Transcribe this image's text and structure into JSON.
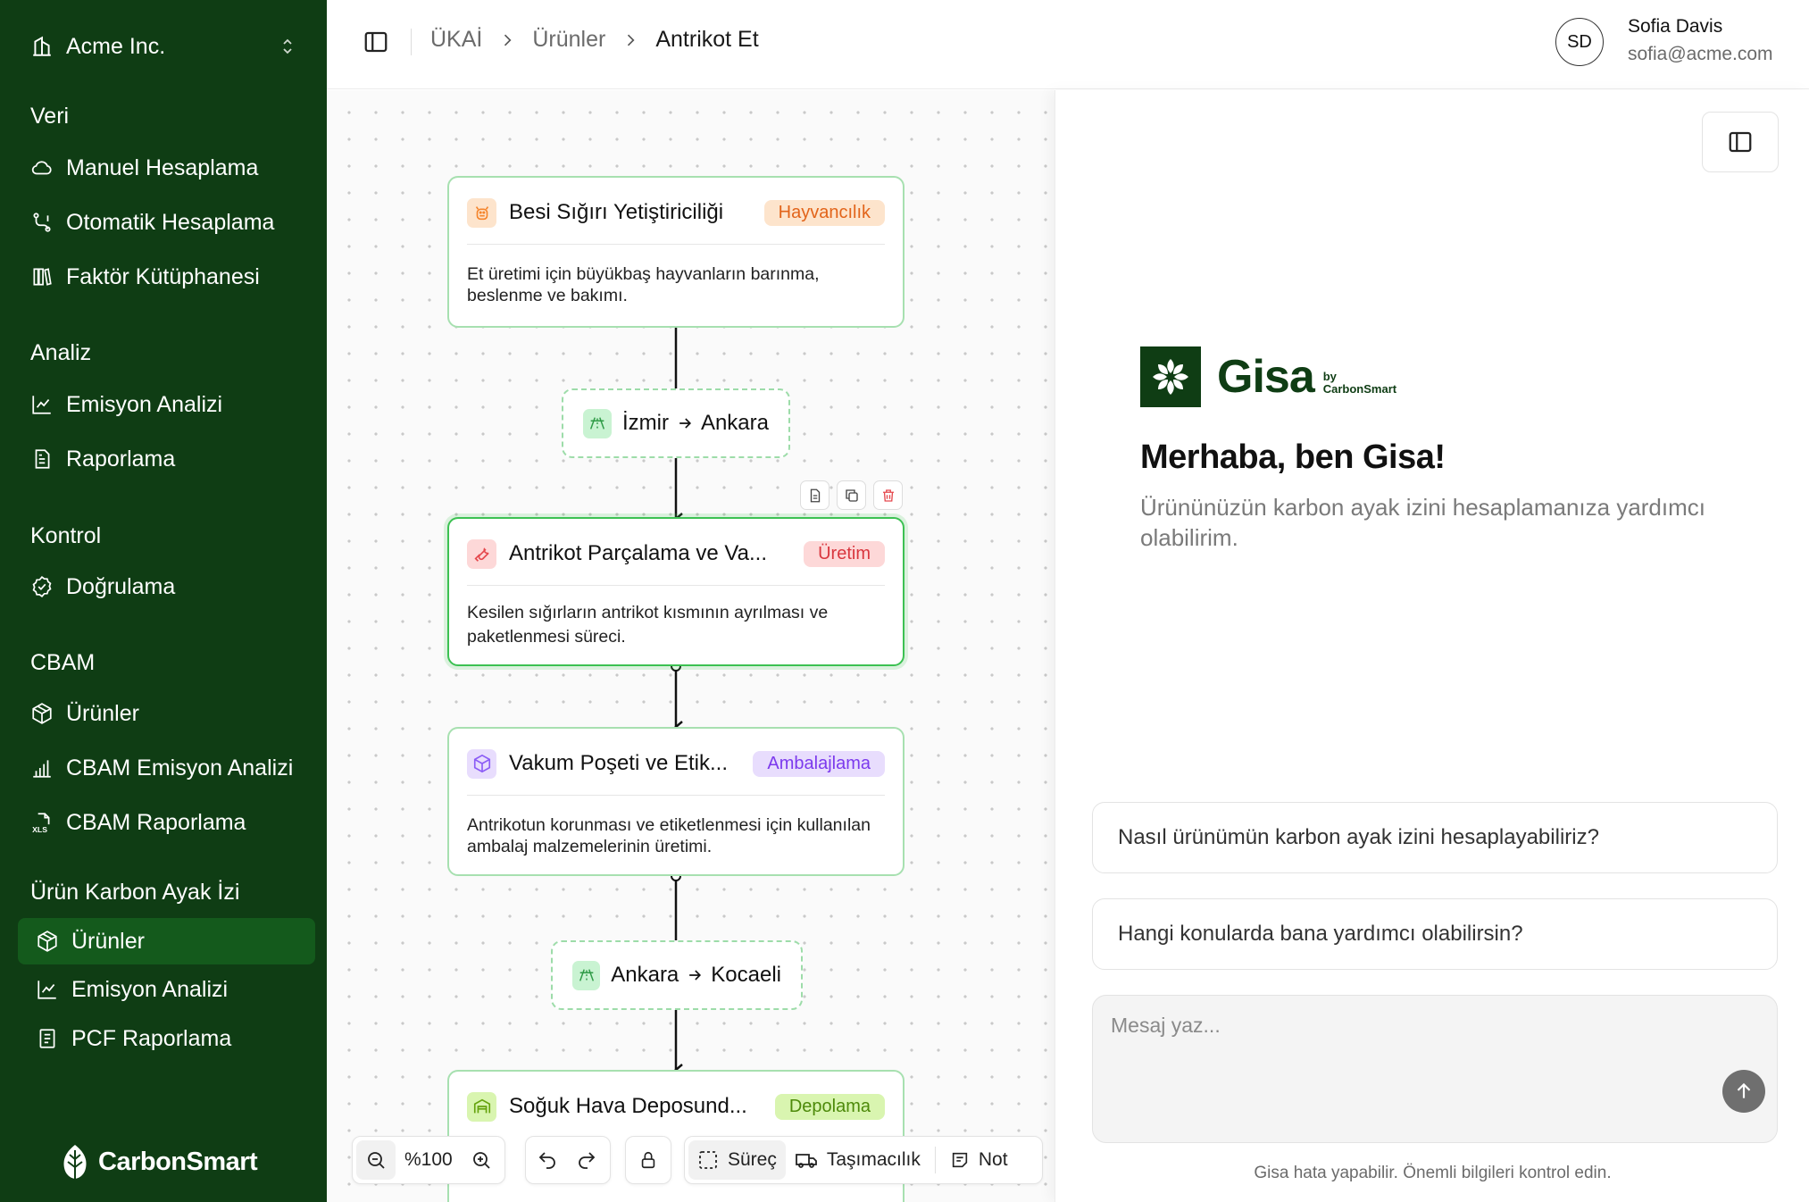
{
  "sidebar": {
    "org_name": "Acme Inc.",
    "sections": [
      {
        "title": "Veri",
        "items": [
          {
            "label": "Manuel Hesaplama",
            "icon": "cloud-icon"
          },
          {
            "label": "Otomatik Hesaplama",
            "icon": "route-icon"
          },
          {
            "label": "Faktör Kütüphanesi",
            "icon": "library-icon"
          }
        ]
      },
      {
        "title": "Analiz",
        "items": [
          {
            "label": "Emisyon Analizi",
            "icon": "chart-line-icon"
          },
          {
            "label": "Raporlama",
            "icon": "report-icon"
          }
        ]
      },
      {
        "title": "Kontrol",
        "items": [
          {
            "label": "Doğrulama",
            "icon": "badge-check-icon"
          }
        ]
      },
      {
        "title": "CBAM",
        "items": [
          {
            "label": "Ürünler",
            "icon": "box-icon"
          },
          {
            "label": "CBAM Emisyon Analizi",
            "icon": "bar-chart-icon"
          },
          {
            "label": "CBAM Raporlama",
            "icon": "xls-file-icon"
          }
        ]
      },
      {
        "title": "Ürün Karbon Ayak İzi",
        "items": [
          {
            "label": "Ürünler",
            "icon": "box-icon",
            "active": true
          },
          {
            "label": "Emisyon Analizi",
            "icon": "chart-line-icon"
          },
          {
            "label": "PCF Raporlama",
            "icon": "document-icon"
          }
        ]
      }
    ],
    "brand": "CarbonSmart"
  },
  "header": {
    "breadcrumbs": [
      "ÜKAİ",
      "Ürünler",
      "Antrikot Et"
    ],
    "user": {
      "initials": "SD",
      "name": "Sofia Davis",
      "email": "sofia@acme.com"
    }
  },
  "canvas": {
    "nodes": [
      {
        "title": "Besi Sığırı Yetiştiriciliği",
        "badge": "Hayvancılık",
        "description": "Et üretimi için büyükbaş hayvanların barınma, beslenme ve bakımı.",
        "icon": "cow-icon",
        "color": "#f5842b",
        "badge_bg": "#fde4cc"
      },
      {
        "title": "Antrikot Parçalama ve Va...",
        "badge": "Üretim",
        "description": "Kesilen sığırların antrikot kısmının ayrılması ve paketlenmesi süreci.",
        "icon": "wrench-icon",
        "color": "#e5484d",
        "badge_bg": "#fdd8d8"
      },
      {
        "title": "Vakum Poşeti ve Etik...",
        "badge": "Ambalajlama",
        "description": "Antrikotun korunması ve etiketlenmesi için kullanılan ambalaj malzemelerinin üretimi.",
        "icon": "package-icon",
        "color": "#8b5cf6",
        "badge_bg": "#e8ddfd"
      },
      {
        "title": "Soğuk Hava Deposund...",
        "badge": "Depolama",
        "description": "",
        "icon": "warehouse-icon",
        "color": "#65a30d",
        "badge_bg": "#d9f5b0"
      }
    ],
    "transports": [
      {
        "from": "İzmir",
        "to": "Ankara"
      },
      {
        "from": "Ankara",
        "to": "Kocaeli"
      }
    ],
    "toolbar": {
      "zoom": "%100",
      "process_label": "Süreç",
      "transport_label": "Taşımacılık",
      "note_label": "Not"
    }
  },
  "chat": {
    "logo_word": "Gisa",
    "logo_by": "by",
    "logo_brand": "CarbonSmart",
    "greeting": "Merhaba, ben Gisa!",
    "subtitle": "Ürününüzün karbon ayak izini hesaplamanıza yardımcı olabilirim.",
    "suggestions": [
      "Nasıl ürünümün karbon ayak izini hesaplayabiliriz?",
      "Hangi konularda bana yardımcı olabilirsin?"
    ],
    "input_placeholder": "Mesaj yaz...",
    "disclaimer": "Gisa hata yapabilir. Önemli bilgileri kontrol edin."
  }
}
